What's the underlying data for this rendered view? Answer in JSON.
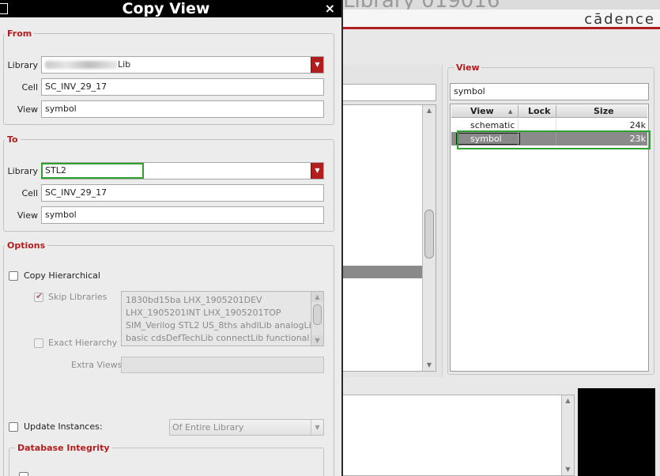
{
  "background": {
    "brand": "cādence",
    "view_panel": {
      "title": "View",
      "filter_value": "symbol",
      "columns": [
        "View",
        "Lock",
        "Size"
      ],
      "sort_indicator": "▲",
      "rows": [
        {
          "view": "schematic",
          "lock": "",
          "size": "24k",
          "selected": false
        },
        {
          "view": "symbol",
          "lock": "",
          "size": "23k",
          "selected": true
        }
      ]
    }
  },
  "dialog": {
    "title": "Copy View",
    "close": "×",
    "from": {
      "title": "From",
      "library_label": "Library",
      "library_value_suffix": "Lib",
      "cell_label": "Cell",
      "cell_value": "SC_INV_29_17",
      "view_label": "View",
      "view_value": "symbol"
    },
    "to": {
      "title": "To",
      "library_label": "Library",
      "library_value": "STL2",
      "cell_label": "Cell",
      "cell_value": "SC_INV_29_17",
      "view_label": "View",
      "view_value": "symbol"
    },
    "options": {
      "title": "Options",
      "copy_hierarchical": "Copy Hierarchical",
      "skip_libraries": "Skip Libraries",
      "skip_libraries_list": [
        "1830bd15ba LHX_1905201DEV",
        "LHX_1905201INT LHX_1905201TOP",
        "SIM_Verilog STL2 US_8ths ahdlLib analogLib",
        "basic cdsDefTechLib connectLib functional"
      ],
      "exact_hierarchy": "Exact Hierarchy",
      "extra_views": "Extra Views",
      "update_instances": "Update Instances:",
      "update_scope": "Of Entire Library"
    },
    "database_integrity": {
      "title": "Database Integrity"
    }
  },
  "colors": {
    "accent": "#b01e1e",
    "highlight": "#2fa12f",
    "selection": "#8a8a8a",
    "titlebar": "#000000"
  }
}
